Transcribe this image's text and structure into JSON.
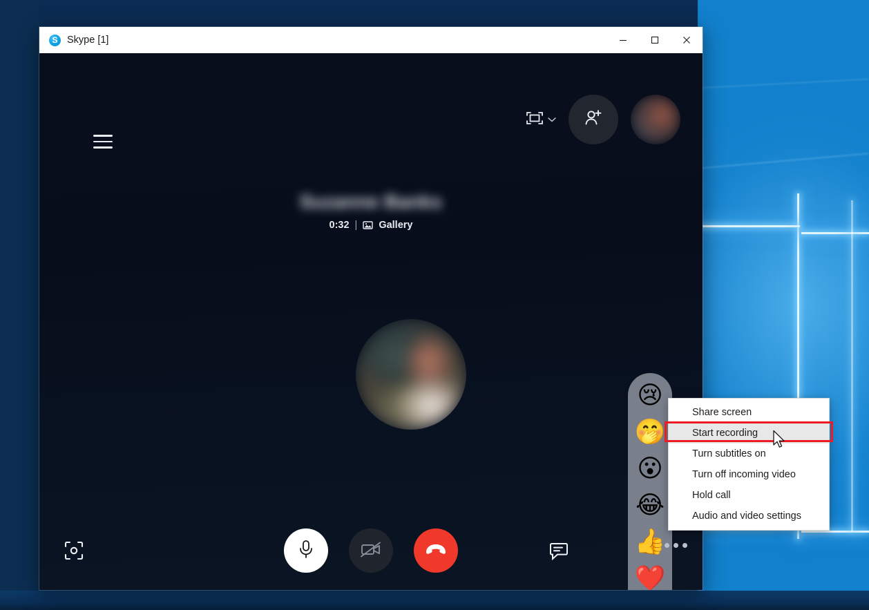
{
  "window": {
    "title": "Skype [1]",
    "logo_icon": "skype-logo-icon",
    "minimize_label": "–",
    "maximize_label": "□",
    "close_label": "✕"
  },
  "call": {
    "menu_icon": "hamburger-menu-icon",
    "layout_icon": "gallery-layout-icon",
    "layout_chevron_icon": "chevron-down-icon",
    "add_person_icon": "add-person-icon",
    "avatar_icon": "user-avatar",
    "contact_name": "Suzanne Banks",
    "duration": "0:32",
    "divider": "|",
    "view_icon": "picture-icon",
    "view_mode": "Gallery",
    "center_avatar_name": "participant-avatar"
  },
  "reactions": {
    "items": [
      {
        "name": "reaction-sad-face",
        "glyph": "😢"
      },
      {
        "name": "reaction-laughing-hand-face",
        "glyph": "🤭"
      },
      {
        "name": "reaction-surprised-face",
        "glyph": "😮"
      },
      {
        "name": "reaction-tears-of-joy-face",
        "glyph": "😂"
      },
      {
        "name": "reaction-thumbs-up",
        "glyph": "👍"
      },
      {
        "name": "reaction-heart",
        "glyph": "❤️"
      }
    ]
  },
  "controls": {
    "snapshot_icon": "snapshot-capture-icon",
    "mic_icon": "microphone-icon",
    "video_off_icon": "camera-off-icon",
    "hangup_icon": "end-call-icon",
    "chat_icon": "chat-bubble-icon",
    "more_icon": "more-options-icon"
  },
  "context_menu": {
    "items": [
      {
        "label": "Share screen",
        "name": "menu-item-share-screen",
        "highlighted": false
      },
      {
        "label": "Start recording",
        "name": "menu-item-start-recording",
        "highlighted": true
      },
      {
        "label": "Turn subtitles on",
        "name": "menu-item-turn-subtitles-on",
        "highlighted": false
      },
      {
        "label": "Turn off incoming video",
        "name": "menu-item-turn-off-incoming-video",
        "highlighted": false
      },
      {
        "label": "Hold call",
        "name": "menu-item-hold-call",
        "highlighted": false
      },
      {
        "label": "Audio and video settings",
        "name": "menu-item-audio-and-video-settings",
        "highlighted": false
      }
    ],
    "highlight_color": "#ed1c24"
  },
  "colors": {
    "accent_red": "#f0392b",
    "skype_blue": "#00aff0",
    "call_background": "#08101e",
    "menu_background": "#ffffff",
    "highlight_row": "#e8e8e8"
  }
}
